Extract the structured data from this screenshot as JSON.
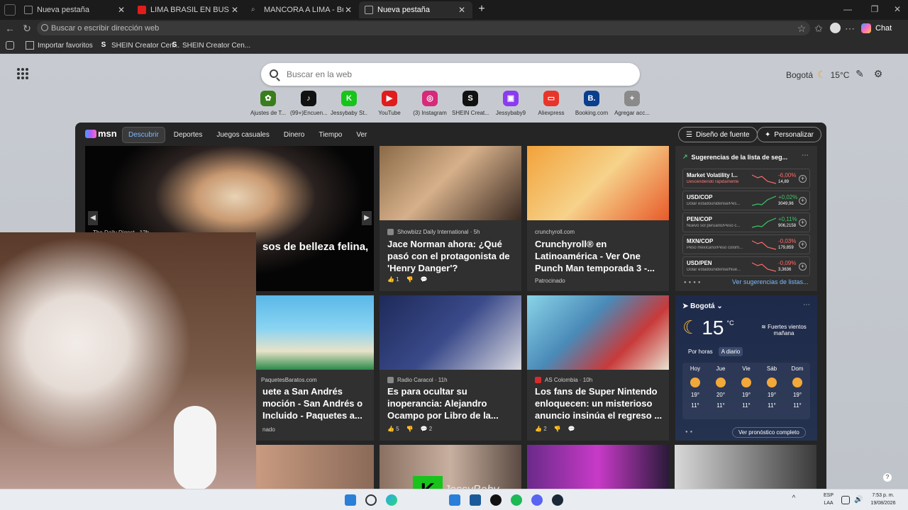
{
  "tabs": [
    {
      "title": "Nueva pestaña",
      "active": false
    },
    {
      "title": "LIMA BRASIL EN BUS - YouTube",
      "active": false
    },
    {
      "title": "MANCORA A LIMA - Búsqueda",
      "active": false
    },
    {
      "title": "Nueva pestaña",
      "active": true
    }
  ],
  "address": {
    "placeholder": "Buscar o escribir dirección web"
  },
  "chat_label": "Chat",
  "favorites": [
    {
      "label": "Importar favoritos",
      "icon": "import-icon"
    },
    {
      "label": "SHEIN Creator Cen...",
      "icon": "S"
    },
    {
      "label": "SHEIN Creator Cen...",
      "icon": "S"
    }
  ],
  "newtab": {
    "search_placeholder": "Buscar en la web",
    "weather_city": "Bogotá",
    "weather_temp": "15°C"
  },
  "shortcuts": [
    {
      "label": "Ajustes de T...",
      "glyph": "✿",
      "color": "#3a7d1d"
    },
    {
      "label": "(99+)Encuen...",
      "glyph": "♪",
      "color": "#111111"
    },
    {
      "label": "Jessybaby St...",
      "glyph": "K",
      "color": "#18c41b"
    },
    {
      "label": "YouTube",
      "glyph": "▶",
      "color": "#e01c1c"
    },
    {
      "label": "(3) Instagram",
      "glyph": "◎",
      "color": "#d62a7a"
    },
    {
      "label": "SHEIN Creat...",
      "glyph": "S",
      "color": "#111111"
    },
    {
      "label": "Jessybaby9",
      "glyph": "▣",
      "color": "#8a3cf0"
    },
    {
      "label": "Aliexpress",
      "glyph": "▭",
      "color": "#e8352a"
    },
    {
      "label": "Booking.com",
      "glyph": "B.",
      "color": "#0a3e8e"
    },
    {
      "label": "Agregar acc...",
      "glyph": "+",
      "color": "#8a8a8a"
    }
  ],
  "msn": {
    "brand": "msn",
    "nav": [
      "Descubrir",
      "Deportes",
      "Juegos casuales",
      "Dinero",
      "Tiempo",
      "Ver"
    ],
    "design_btn": "Diseño de fuente",
    "personalize_btn": "Personalizar",
    "hero": {
      "source": "The Daily Digest · 12h",
      "headline": "sos de belleza felina,"
    },
    "cards": [
      {
        "source": "Showbizz Daily International · 5h",
        "headline": "Jace Norman ahora: ¿Qué pasó con el protagonista de 'Henry Danger'?",
        "likes": "1",
        "bg": "#6a5a4a"
      },
      {
        "source": "crunchyroll.com",
        "headline": "Crunchyroll® en Latinoamérica - Ver One Punch Man temporada 3 -...",
        "sponsor": "Patrocinado",
        "bg": "#e88a2a"
      },
      {
        "source": "PaquetesBaratos.com",
        "headline": "uete a San Andrés moción - San Andrés o Incluido - Paquetes a...",
        "sponsor": "nado",
        "bg": "#4aa0c8"
      },
      {
        "source": "Radio Caracol · 11h",
        "headline": "Es para ocultar su inoperancia: Alejandro Ocampo por Libro de la...",
        "likes": "5",
        "comments": "2",
        "bg": "#2a3a6a"
      },
      {
        "source": "AS Colombia · 10h",
        "headline": "Los fans de Super Nintendo enloquecen: un misterioso anuncio insinúa el regreso ...",
        "likes": "2",
        "bg": "#5aa0b8"
      }
    ],
    "stocks": {
      "title": "Sugerencias de la lista de seg...",
      "more": "Ver sugerencias de listas...",
      "rows": [
        {
          "symbol": "Market Volatility I...",
          "desc": "Descendiendo rápidamente",
          "pct": "-6,00%",
          "value": "14,89",
          "up": false
        },
        {
          "symbol": "USD/COP",
          "desc": "Dólar estadounidense/Pes...",
          "pct": "+0,02%",
          "value": "3049,96",
          "up": true
        },
        {
          "symbol": "PEN/COP",
          "desc": "Nuevo sol peruano/Peso c...",
          "pct": "+0,11%",
          "value": "906,2158",
          "up": true
        },
        {
          "symbol": "MXN/COP",
          "desc": "Peso mexicano/Peso colom...",
          "pct": "-0,03%",
          "value": "179,859",
          "up": false
        },
        {
          "symbol": "USD/PEN",
          "desc": "Dólar estadounidense/Nue...",
          "pct": "-0,09%",
          "value": "3,3636",
          "up": false
        }
      ]
    },
    "weather": {
      "city": "Bogotá",
      "temp": "15",
      "unit": "°C",
      "condition": "Fuertes vientos mañana",
      "tab_hourly": "Por horas",
      "tab_daily": "A diario",
      "more": "Ver pronóstico completo",
      "days": [
        {
          "day": "Hoy",
          "hi": "19°",
          "lo": "11°"
        },
        {
          "day": "Jue",
          "hi": "20°",
          "lo": "11°"
        },
        {
          "day": "Vie",
          "hi": "19°",
          "lo": "11°"
        },
        {
          "day": "Sáb",
          "hi": "19°",
          "lo": "11°"
        },
        {
          "day": "Dom",
          "hi": "19°",
          "lo": "11°"
        }
      ]
    }
  },
  "overlay": {
    "text": "JessyBaby"
  },
  "taskbar": {
    "lang": "ESP",
    "lang2": "LAA",
    "time": "7:53 p. m.",
    "date": "19/08/2026"
  }
}
